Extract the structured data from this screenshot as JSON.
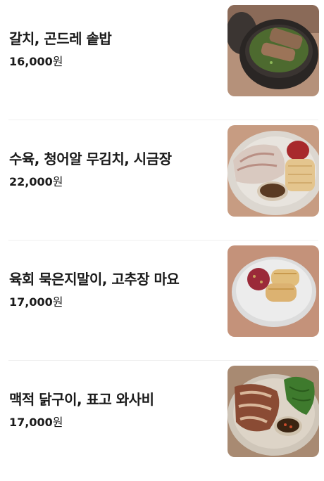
{
  "menu": [
    {
      "name": "갈치, 곤드레 솥밥",
      "price": "16,000",
      "currency": "원",
      "image_icon": "galchi-gondre-sotbap-photo"
    },
    {
      "name": "수육, 청어알 무김치, 시금장",
      "price": "22,000",
      "currency": "원",
      "image_icon": "suyuk-plate-photo"
    },
    {
      "name": "육회 묵은지말이, 고추장 마요",
      "price": "17,000",
      "currency": "원",
      "image_icon": "yukhoe-mukeunji-roll-photo"
    },
    {
      "name": "맥적 닭구이, 표고 와사비",
      "price": "17,000",
      "currency": "원",
      "image_icon": "maekjeok-chicken-photo"
    }
  ]
}
